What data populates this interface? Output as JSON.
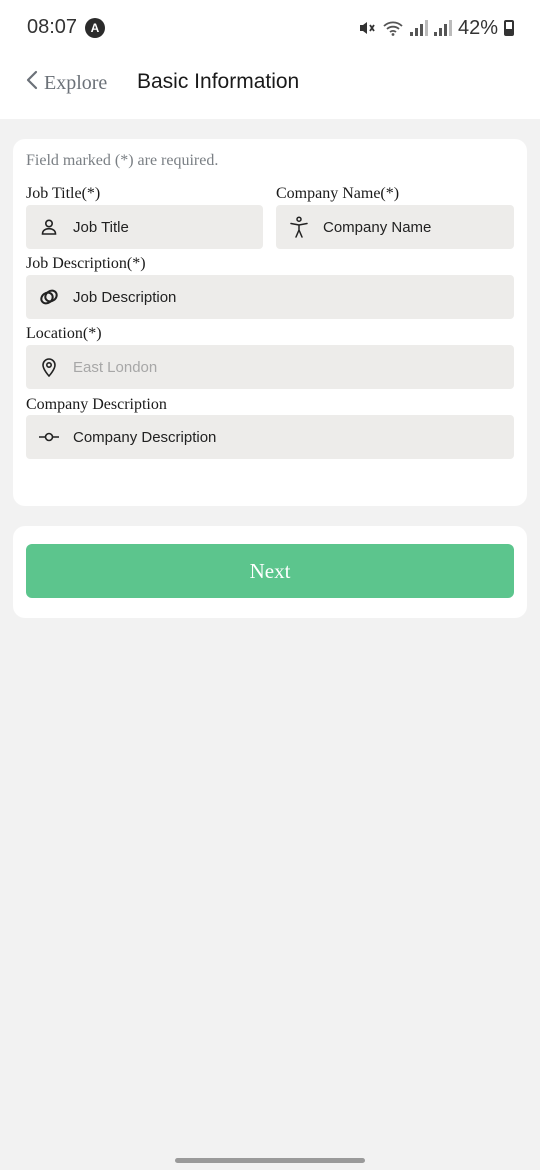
{
  "status_bar": {
    "time": "08:07",
    "app_badge": "A",
    "battery": "42%"
  },
  "header": {
    "back_label": "Explore",
    "title": "Basic Information"
  },
  "form": {
    "required_note": "Field marked (*) are required.",
    "fields": [
      {
        "label": "Job Title(*)",
        "value": "Job Title",
        "icon": "person-icon",
        "is_placeholder": false
      },
      {
        "label": "Company Name(*)",
        "value": "Company Name",
        "icon": "accessibility-icon",
        "is_placeholder": false
      },
      {
        "label": "Job Description(*)",
        "value": "Job Description",
        "icon": "interlocked-rings-icon",
        "is_placeholder": false
      },
      {
        "label": "Location(*)",
        "value": "East London",
        "icon": "location-pin-icon",
        "is_placeholder": true
      },
      {
        "label": "Company Description",
        "value": "Company Description",
        "icon": "commit-icon",
        "is_placeholder": false
      }
    ]
  },
  "actions": {
    "next_label": "Next"
  },
  "colors": {
    "primary_button": "#5cc58d",
    "field_background": "#edecea",
    "page_background": "#f2f2f2"
  }
}
